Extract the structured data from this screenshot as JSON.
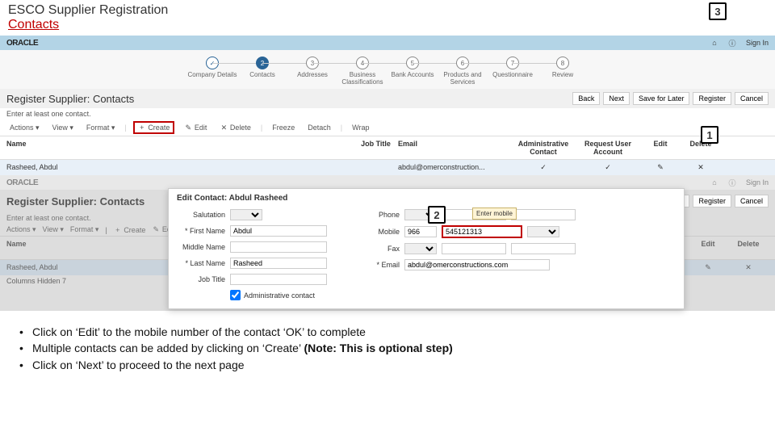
{
  "slide": {
    "title": "ESCO Supplier Registration",
    "subtitle": "Contacts"
  },
  "oracle": {
    "logo": "ORACLE",
    "signin": "Sign In"
  },
  "steps": [
    {
      "label": "Company Details"
    },
    {
      "label": "Contacts",
      "num": "2"
    },
    {
      "label": "Addresses",
      "num": "3"
    },
    {
      "label": "Business Classifications",
      "num": "4"
    },
    {
      "label": "Bank Accounts",
      "num": "5"
    },
    {
      "label": "Products and Services",
      "num": "6"
    },
    {
      "label": "Questionnaire",
      "num": "7"
    },
    {
      "label": "Review",
      "num": "8"
    }
  ],
  "page_title": "Register Supplier: Contacts",
  "buttons": {
    "back": "Back",
    "next": "Next",
    "save": "Save for Later",
    "register": "Register",
    "cancel": "Cancel"
  },
  "hint": "Enter at least one contact.",
  "toolbar": {
    "actions": "Actions ▾",
    "view": "View ▾",
    "format": "Format ▾",
    "create": "Create",
    "edit": "Edit",
    "delete": "Delete",
    "freeze": "Freeze",
    "detach": "Detach",
    "wrap": "Wrap"
  },
  "table": {
    "headers": {
      "name": "Name",
      "job": "Job Title",
      "email": "Email",
      "admin": "Administrative Contact",
      "req": "Request User Account",
      "edit": "Edit",
      "del": "Delete"
    },
    "row": {
      "name": "Rasheed, Abdul",
      "email": "abdul@omerconstruction..."
    }
  },
  "callouts": {
    "c1": "1",
    "c2": "2",
    "c3": "3"
  },
  "columns_hidden": "Columns Hidden 7",
  "modal": {
    "title": "Edit Contact: Abdul Rasheed",
    "labels": {
      "salutation": "Salutation",
      "first": "First Name",
      "middle": "Middle Name",
      "last": "Last Name",
      "job": "Job Title",
      "admin": "Administrative contact",
      "phone": "Phone",
      "mobile": "Mobile",
      "fax": "Fax",
      "email": "Email"
    },
    "values": {
      "first": "Abdul",
      "last": "Rasheed",
      "cc": "966",
      "mobile": "545121313",
      "email": "abdul@omerconstructions.com"
    },
    "tooltip": "Enter mobile"
  },
  "bullets": [
    "Click on ‘Edit’  to the mobile number of the contact ‘OK’ to complete",
    "Multiple contacts can be added by clicking on ‘Create’ (Note: This is optional step)",
    "Click on ‘Next’ to proceed to the next page"
  ]
}
